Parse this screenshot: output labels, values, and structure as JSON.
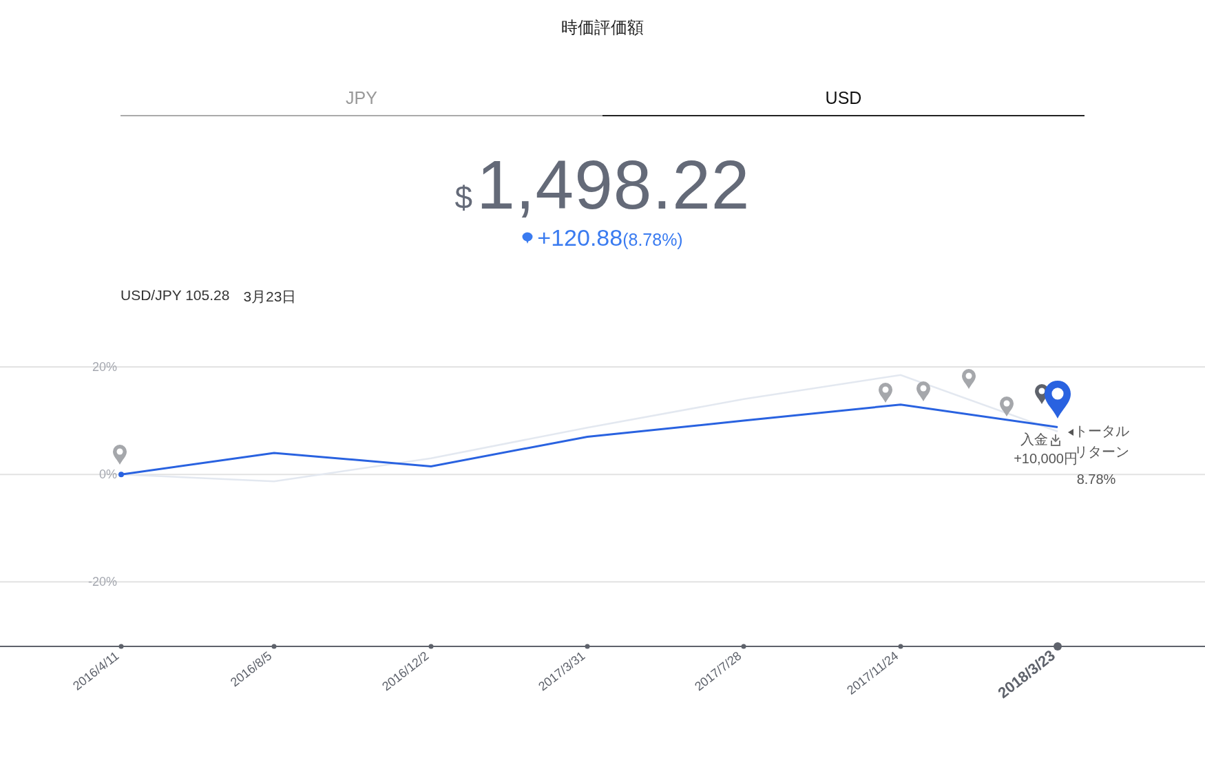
{
  "title": "時価評価額",
  "tabs": [
    {
      "label": "JPY",
      "selected": false
    },
    {
      "label": "USD",
      "selected": true
    }
  ],
  "valuation": {
    "currency": "$",
    "amount": "1,498.22",
    "change": "+120.88",
    "change_percent": "(8.78%)"
  },
  "rate": {
    "label": "USD/JPY 105.28",
    "date": "3月23日"
  },
  "chart_data": {
    "type": "line",
    "categories": [
      "2016/4/11",
      "2016/8/5",
      "2016/12/2",
      "2017/3/31",
      "2017/7/28",
      "2017/11/24",
      "2018/3/23"
    ],
    "series": [
      {
        "color": "#2962e0",
        "values": [
          0,
          4,
          1.5,
          7,
          10,
          13,
          8.8
        ]
      },
      {
        "color": "#e3e8f0",
        "values": [
          0,
          -1.3,
          3,
          8.7,
          14,
          18.5,
          8
        ]
      }
    ],
    "ylim": [
      -32,
      20
    ],
    "grid": true,
    "yticks": [
      {
        "value": 20,
        "label": "20%"
      },
      {
        "value": 0,
        "label": "0%"
      },
      {
        "value": -20,
        "label": "-20%"
      }
    ]
  },
  "chart_notes": {
    "deposit": {
      "label": "入金",
      "amount": "+10,000円"
    },
    "total_return": {
      "label": "トータルリターン",
      "value": "8.78%"
    }
  }
}
